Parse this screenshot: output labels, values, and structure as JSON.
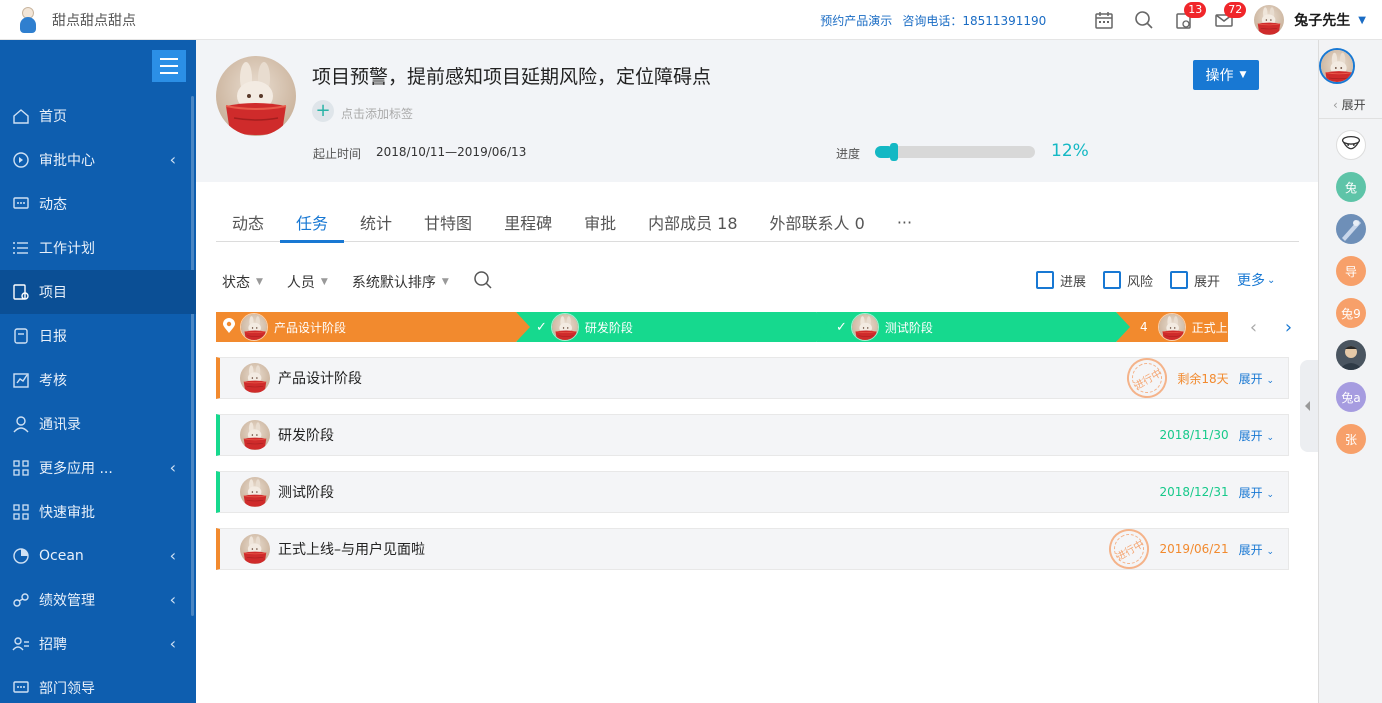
{
  "header": {
    "app_title": "甜点甜点甜点",
    "demo_link": "预约产品演示",
    "hotline": "咨询电话：18511391190",
    "notif_badge": "13",
    "mail_badge": "72",
    "user_name": "兔子先生"
  },
  "sidebar": {
    "items": [
      {
        "label": "首页",
        "icon": "home-icon",
        "has_arrow": false
      },
      {
        "label": "审批中心",
        "icon": "approval-icon",
        "has_arrow": true
      },
      {
        "label": "动态",
        "icon": "message-icon",
        "has_arrow": false
      },
      {
        "label": "工作计划",
        "icon": "list-icon",
        "has_arrow": false
      },
      {
        "label": "项目",
        "icon": "project-icon",
        "has_arrow": false,
        "active": true
      },
      {
        "label": "日报",
        "icon": "report-icon",
        "has_arrow": false
      },
      {
        "label": "考核",
        "icon": "assess-icon",
        "has_arrow": false
      },
      {
        "label": "通讯录",
        "icon": "contact-icon",
        "has_arrow": false
      },
      {
        "label": "更多应用 ...",
        "icon": "apps-icon",
        "has_arrow": true
      },
      {
        "label": "快速审批",
        "icon": "quick-approval-icon",
        "has_arrow": false
      },
      {
        "label": "Ocean",
        "icon": "pie-icon",
        "has_arrow": true
      },
      {
        "label": "绩效管理",
        "icon": "performance-icon",
        "has_arrow": true
      },
      {
        "label": "招聘",
        "icon": "recruit-icon",
        "has_arrow": true
      },
      {
        "label": "部门领导",
        "icon": "leader-icon",
        "has_arrow": false
      }
    ]
  },
  "project": {
    "title": "项目预警，提前感知项目延期风险，定位障碍点",
    "add_tag": "点击添加标签",
    "period_label": "起止时间",
    "period_value": "2018/10/11—2019/06/13",
    "operate_label": "操作",
    "progress_label": "进度",
    "progress_percent": 12,
    "progress_text": "12%"
  },
  "tabs": [
    {
      "label": "动态"
    },
    {
      "label": "任务",
      "active": true
    },
    {
      "label": "统计"
    },
    {
      "label": "甘特图"
    },
    {
      "label": "里程碑"
    },
    {
      "label": "审批"
    },
    {
      "label": "内部成员 18"
    },
    {
      "label": "外部联系人 0"
    },
    {
      "label": "···"
    }
  ],
  "filters": {
    "status": "状态",
    "person": "人员",
    "sort": "系统默认排序",
    "chk_progress": "进展",
    "chk_risk": "风险",
    "chk_expand": "展开",
    "more": "更多"
  },
  "flow": {
    "segments": [
      {
        "label": "产品设计阶段",
        "color": "#f28a2e",
        "marker": "pin"
      },
      {
        "label": "研发阶段",
        "color": "#16d98e",
        "marker": "check"
      },
      {
        "label": "测试阶段",
        "color": "#16d98e",
        "marker": "check"
      },
      {
        "label": "正式上线",
        "color": "#f28a2e",
        "marker": "4"
      }
    ]
  },
  "stages": [
    {
      "name": "产品设计阶段",
      "status_color": "orange",
      "stamp": "进行中",
      "info": "剩余18天",
      "expand": "展开"
    },
    {
      "name": "研发阶段",
      "status_color": "green",
      "stamp": "",
      "info": "2018/11/30",
      "expand": "展开"
    },
    {
      "name": "测试阶段",
      "status_color": "green",
      "stamp": "",
      "info": "2018/12/31",
      "expand": "展开"
    },
    {
      "name": "正式上线–与用户见面啦",
      "status_color": "orange",
      "stamp": "进行中",
      "info": "2019/06/21",
      "expand": "展开"
    }
  ],
  "right_panel": {
    "expand_label": "展开",
    "members": [
      {
        "label": "",
        "kind": "avatar-sketch"
      },
      {
        "label": "兔",
        "kind": "green"
      },
      {
        "label": "",
        "kind": "avatar-blue"
      },
      {
        "label": "导",
        "kind": "orange"
      },
      {
        "label": "兔9",
        "kind": "orange"
      },
      {
        "label": "",
        "kind": "avatar-grey"
      },
      {
        "label": "兔a",
        "kind": "purple"
      },
      {
        "label": "张",
        "kind": "orange"
      }
    ]
  },
  "colors": {
    "primary": "#1878d3",
    "sidebar": "#0e5eaf",
    "orange": "#f28a2e",
    "green": "#16d98e",
    "progress": "#14b8c4"
  }
}
